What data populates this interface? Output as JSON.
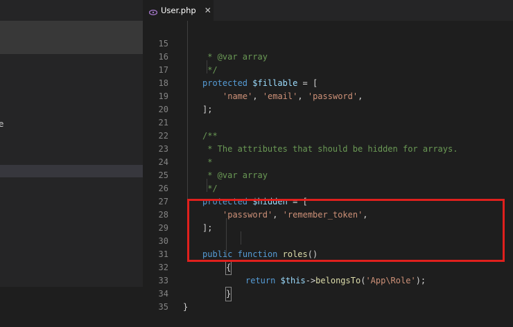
{
  "tab": {
    "label": "User.php",
    "close": "✕"
  },
  "sidebar": {
    "edge_text": "e"
  },
  "lines": [
    {
      "num": "15",
      "text": " * @var array"
    },
    {
      "num": "16",
      "text": " */"
    },
    {
      "num": "17",
      "kw": "protected",
      "var": "$fillable",
      "rest": " = ["
    },
    {
      "num": "18",
      "s1": "'name'",
      "s2": "'email'",
      "s3": "'password'"
    },
    {
      "num": "19",
      "text": "];"
    },
    {
      "num": "20",
      "text": ""
    },
    {
      "num": "21",
      "text": "/**"
    },
    {
      "num": "22",
      "text": " * The attributes that should be hidden for arrays."
    },
    {
      "num": "23",
      "text": " *"
    },
    {
      "num": "24",
      "text": " * @var array"
    },
    {
      "num": "25",
      "text": " */"
    },
    {
      "num": "26",
      "kw": "protected",
      "var": "$hidden",
      "rest": " = ["
    },
    {
      "num": "27",
      "s1": "'password'",
      "s2": "'remember_token'"
    },
    {
      "num": "28",
      "text": "];"
    },
    {
      "num": "29",
      "text": ""
    },
    {
      "num": "30",
      "kw1": "public",
      "kw2": "function",
      "fn": "roles",
      "rest": "()"
    },
    {
      "num": "31",
      "text": "{"
    },
    {
      "num": "32",
      "kw": "return",
      "var": "$this",
      "arrow": "->",
      "fn": "belongsTo",
      "str": "'App\\Role'",
      "rest": ");"
    },
    {
      "num": "33",
      "text": "}"
    },
    {
      "num": "34",
      "text": "}"
    },
    {
      "num": "35",
      "text": ""
    }
  ]
}
